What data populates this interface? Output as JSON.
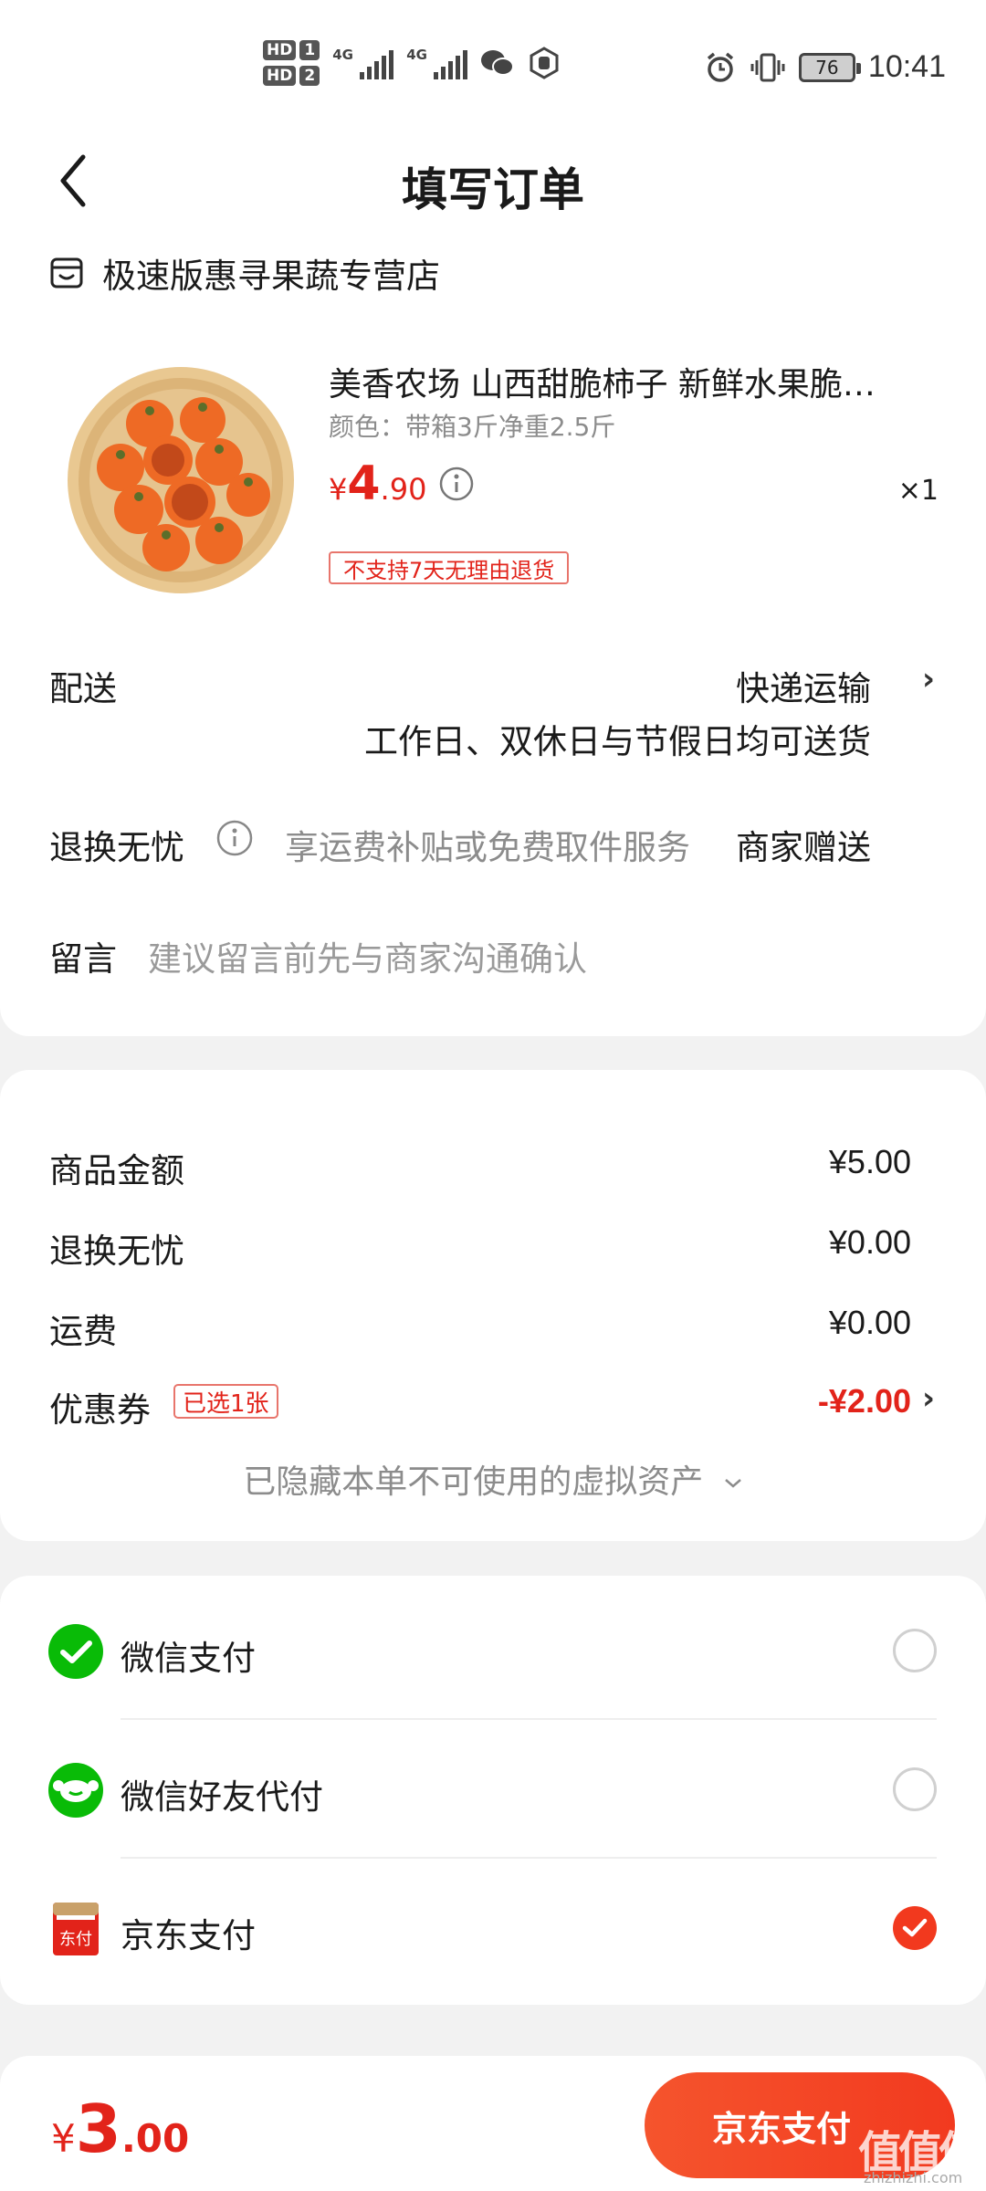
{
  "status_bar": {
    "hd1": "HD",
    "hd1_num": "1",
    "hd2": "HD",
    "hd2_num": "2",
    "net1": "4G",
    "net2": "4G",
    "battery": "76",
    "time": "10:41"
  },
  "header": {
    "title": "填写订单"
  },
  "store": {
    "name": "极速版惠寻果蔬专营店"
  },
  "product": {
    "title": "美香农场 山西甜脆柿子 新鲜水果脆…",
    "spec": "颜色：带箱3斤净重2.5斤",
    "price_currency": "¥",
    "price_int": "4",
    "price_dec": ".90",
    "quantity": "×1",
    "return_policy": "不支持7天无理由退货"
  },
  "delivery": {
    "label": "配送",
    "method": "快递运输",
    "note": "工作日、双休日与节假日均可送货"
  },
  "return_worry_free": {
    "label": "退换无忧",
    "desc": "享运费补贴或免费取件服务",
    "value": "商家赠送"
  },
  "message": {
    "label": "留言",
    "placeholder": "建议留言前先与商家沟通确认"
  },
  "costs": {
    "goods_label": "商品金额",
    "goods_value": "¥5.00",
    "return_label": "退换无忧",
    "return_value": "¥0.00",
    "shipping_label": "运费",
    "shipping_value": "¥0.00",
    "coupon_label": "优惠券",
    "coupon_tag": "已选1张",
    "coupon_value": "-¥2.00",
    "hidden_assets": "已隐藏本单不可使用的虚拟资产"
  },
  "payment": {
    "options": [
      {
        "label": "微信支付",
        "selected": false
      },
      {
        "label": "微信好友代付",
        "selected": false
      },
      {
        "label": "京东支付",
        "selected": true
      }
    ],
    "jd_icon_text": "东付"
  },
  "footer": {
    "total_currency": "¥",
    "total_int": "3",
    "total_dec": ".00",
    "pay_button": "京东支付"
  },
  "watermark": {
    "main": "值值值",
    "sub": "zhizhizhi.com"
  },
  "colors": {
    "accent": "#e2231a",
    "button": "#f23a1f",
    "wechat": "#09bb07"
  }
}
